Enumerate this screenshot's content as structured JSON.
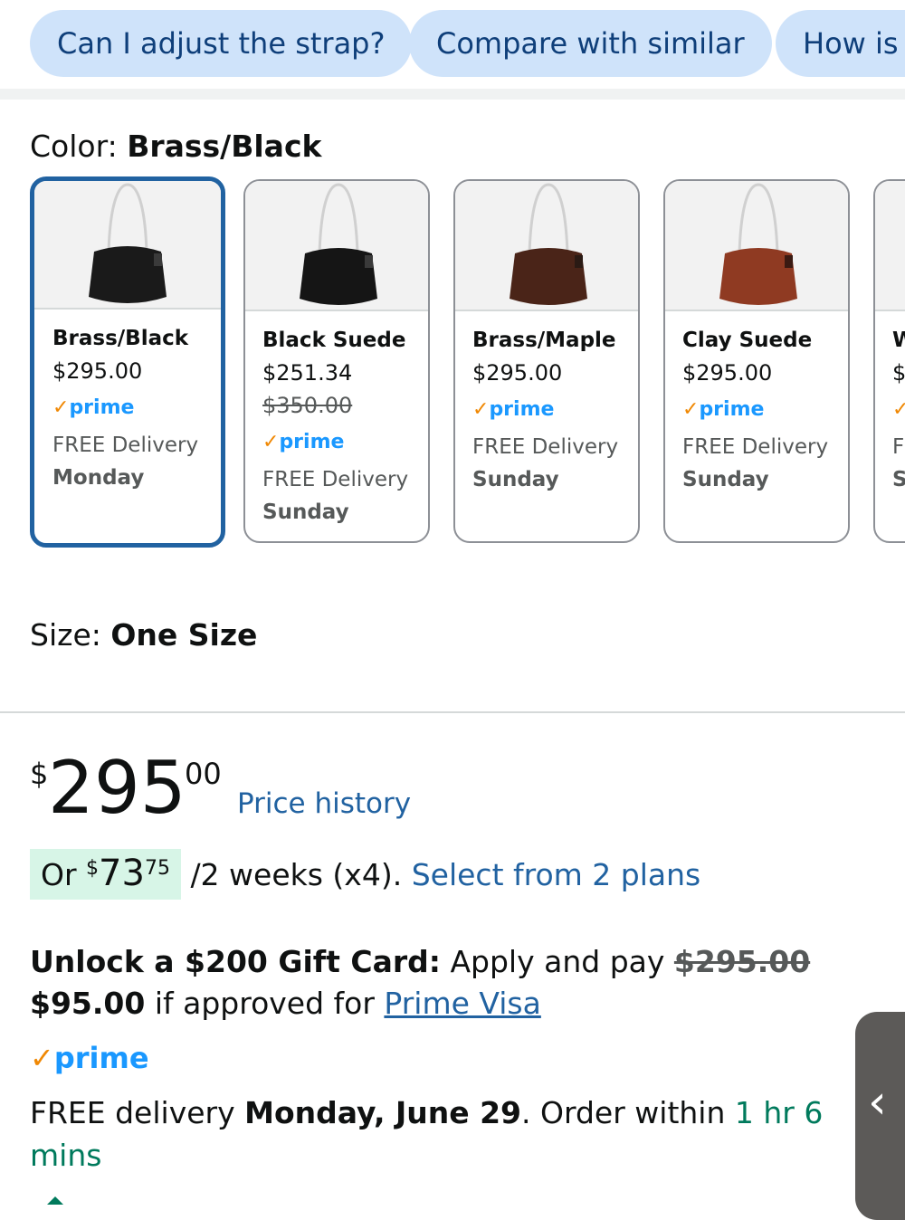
{
  "chips": [
    "Can I adjust the strap?",
    "Compare with similar",
    "How is t"
  ],
  "color": {
    "label": "Color: ",
    "value": "Brass/Black"
  },
  "swatches": [
    {
      "name": "Brass/Black",
      "price": "$295.00",
      "strike": "",
      "prime": "prime",
      "delivery": "FREE Delivery",
      "day": "Monday",
      "bag_color": "#1a1a1a",
      "selected": true
    },
    {
      "name": "Black Suede",
      "price": "$251.34",
      "strike": "$350.00",
      "prime": "prime",
      "delivery": "FREE Delivery",
      "day": "Sunday",
      "bag_color": "#151515",
      "selected": false
    },
    {
      "name": "Brass/Maple",
      "price": "$295.00",
      "strike": "",
      "prime": "prime",
      "delivery": "FREE Delivery",
      "day": "Sunday",
      "bag_color": "#4a2418",
      "selected": false
    },
    {
      "name": "Clay Suede",
      "price": "$295.00",
      "strike": "",
      "prime": "prime",
      "delivery": "FREE Delivery",
      "day": "Sunday",
      "bag_color": "#8f3a22",
      "selected": false
    },
    {
      "name": "W",
      "price": "$",
      "strike": "",
      "prime": "",
      "delivery": "F",
      "day": "S",
      "bag_color": "#f2f2f2",
      "selected": false
    }
  ],
  "size": {
    "label": "Size: ",
    "value": "One Size"
  },
  "price": {
    "symbol": "$",
    "whole": "295",
    "fraction": "00",
    "history_link": "Price history"
  },
  "installment": {
    "prefix": "Or ",
    "symbol": "$",
    "whole": "73",
    "fraction": "75",
    "suffix": " /2 weeks (x4). ",
    "link": "Select from 2 plans"
  },
  "giftcard": {
    "bold": "Unlock a $200 Gift Card:",
    "text1": " Apply and pay ",
    "strike": "$295.00",
    "price": "$95.00",
    "text2": " if approved for ",
    "link": "Prime Visa"
  },
  "prime_badge": "prime",
  "delivery": {
    "prefix": "FREE delivery ",
    "date": "Monday, June 29",
    "middle": ". Order within ",
    "countdown": "1 hr 6 mins"
  },
  "side_handle_glyph": "‹"
}
